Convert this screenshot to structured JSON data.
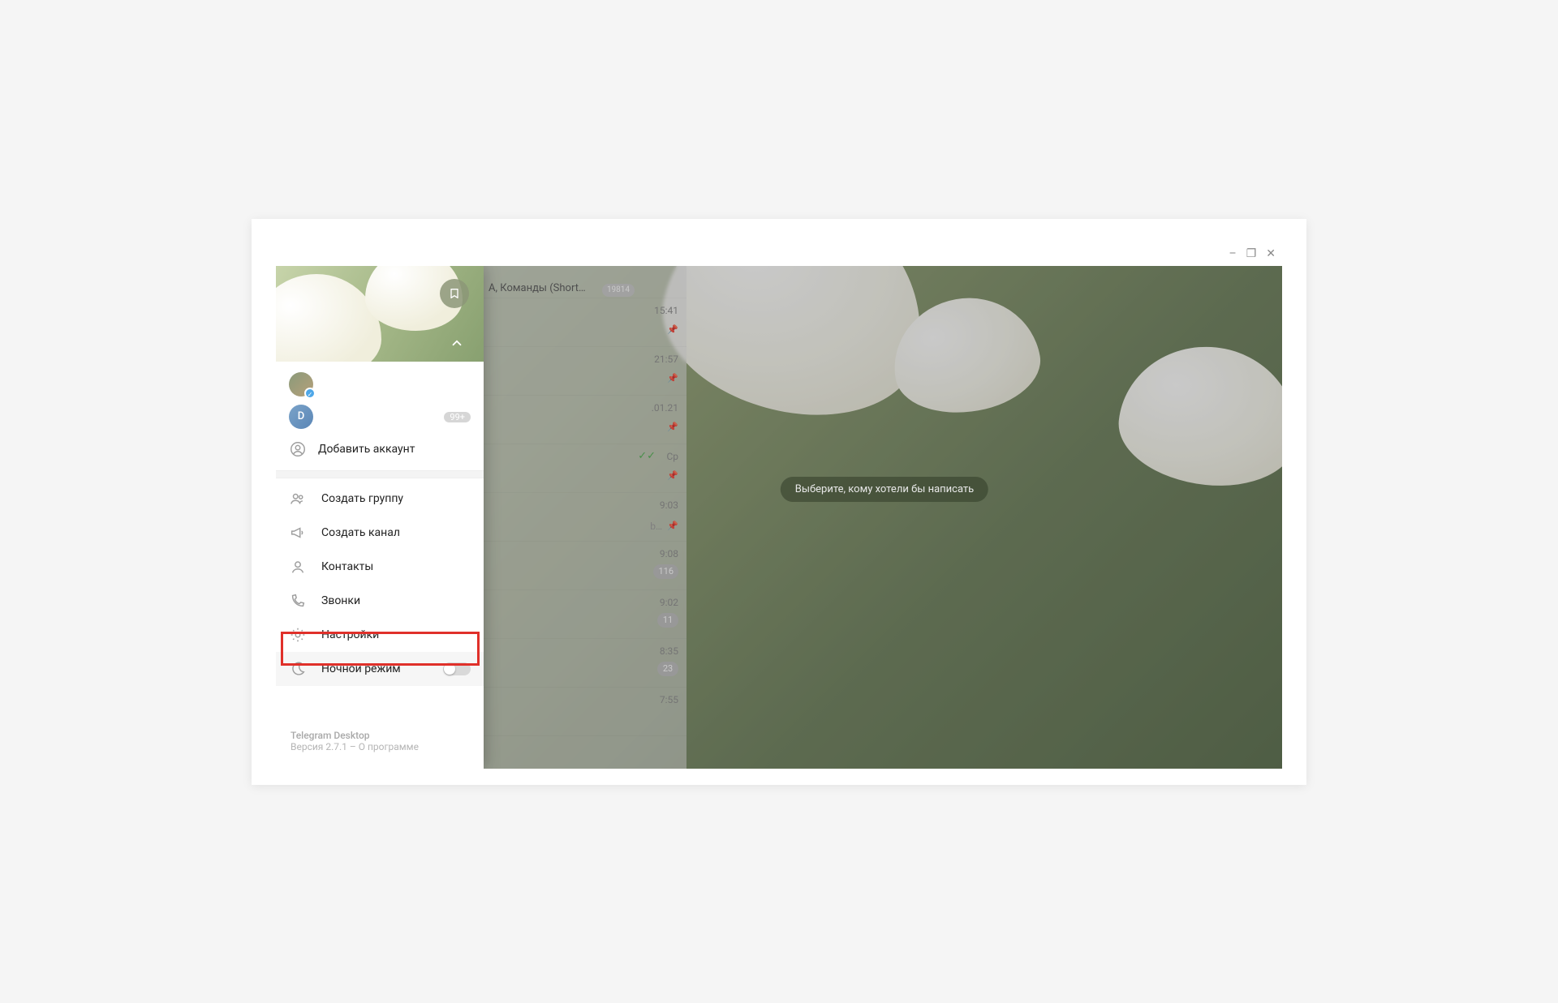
{
  "window": {
    "min": "–",
    "max": "❐",
    "close": "✕"
  },
  "sidebar": {
    "accounts": {
      "a1_initial": "",
      "a2_initial": "D",
      "a2_badge": "99+",
      "add_label": "Добавить аккаунт"
    },
    "menu": {
      "new_group": "Создать группу",
      "new_channel": "Создать канал",
      "contacts": "Контакты",
      "calls": "Звонки",
      "settings": "Настройки",
      "night": "Ночной режим"
    },
    "footer": {
      "app": "Telegram Desktop",
      "version": "Версия 2.7.1 – О программе"
    }
  },
  "chatlist": {
    "r0_title": "А, Команды (Short…",
    "r0_badge": "19814",
    "r1_time": "15:41",
    "r2_time": "21:57",
    "r3_time": ".01.21",
    "r4_time": "Ср",
    "r5_time": "9:03",
    "r5_text": "b…",
    "r6_time": "9:08",
    "r6_badge": "116",
    "r7_time": "9:02",
    "r7_badge": "11",
    "r8_time": "8:35",
    "r8_badge": "23",
    "r9_time": "7:55"
  },
  "main": {
    "hint": "Выберите, кому хотели бы написать"
  }
}
